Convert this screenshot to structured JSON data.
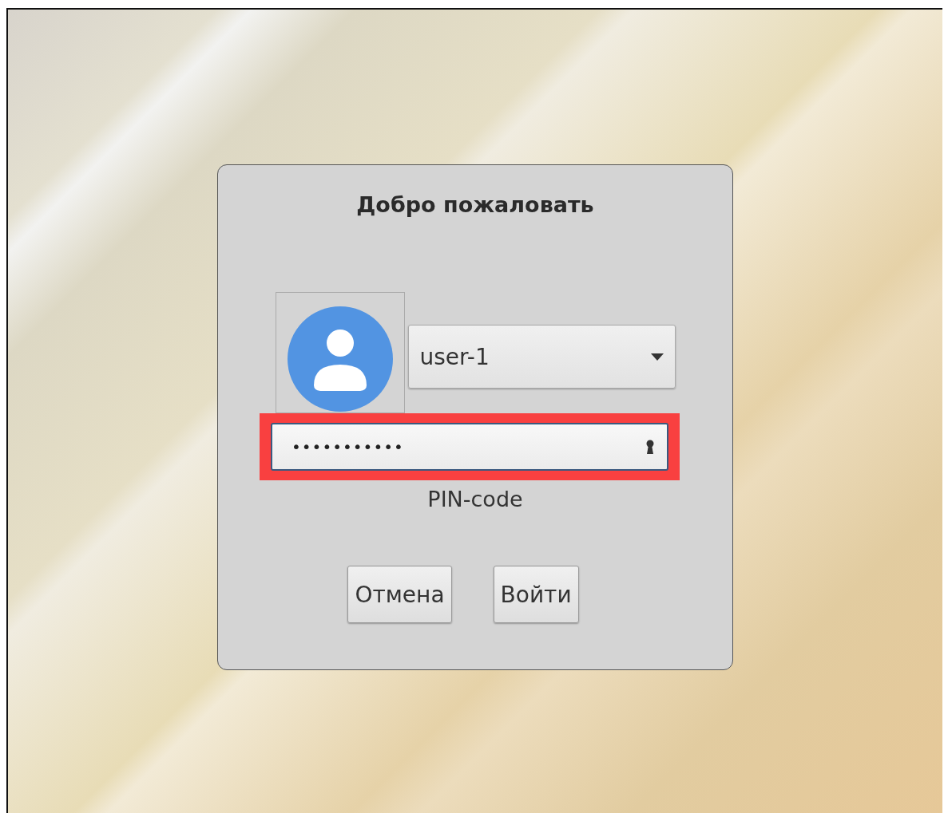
{
  "dialog": {
    "title": "Добро пожаловать",
    "user_select": {
      "value": "user-1"
    },
    "password": {
      "value": "•••••••••••",
      "highlighted": true
    },
    "field_caption": "PIN-code",
    "buttons": [
      "Отмена",
      "Войти"
    ]
  }
}
